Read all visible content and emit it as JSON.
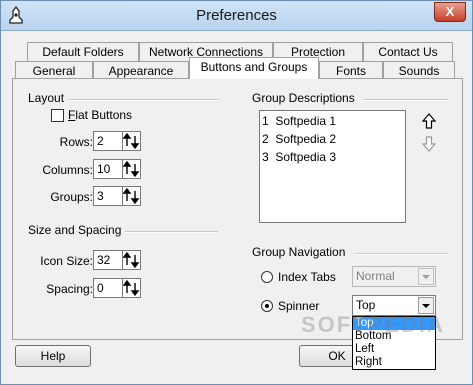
{
  "window": {
    "title": "Preferences",
    "close_glyph": "X"
  },
  "tabs_row1": [
    "Default Folders",
    "Network Connections",
    "Protection",
    "Contact Us"
  ],
  "tabs_row2": [
    "General",
    "Appearance",
    "Buttons and Groups",
    "Fonts",
    "Sounds"
  ],
  "selected_tab": "Buttons and Groups",
  "layout": {
    "heading": "Layout",
    "flat_buttons_label": "Flat Buttons",
    "flat_buttons_checked": false,
    "rows_label": "Rows:",
    "rows_value": "2",
    "columns_label": "Columns:",
    "columns_value": "10",
    "groups_label": "Groups:",
    "groups_value": "3"
  },
  "size_spacing": {
    "heading": "Size and Spacing",
    "icon_size_label": "Icon Size:",
    "icon_size_value": "32",
    "spacing_label": "Spacing:",
    "spacing_value": "0"
  },
  "group_descriptions": {
    "heading": "Group Descriptions",
    "items": [
      {
        "num": "1",
        "name": "Softpedia 1"
      },
      {
        "num": "2",
        "name": "Softpedia 2"
      },
      {
        "num": "3",
        "name": "Softpedia 3"
      }
    ]
  },
  "group_navigation": {
    "heading": "Group Navigation",
    "index_tabs_label": "Index Tabs",
    "index_tabs_value": "Normal",
    "spinner_label": "Spinner",
    "spinner_value": "Top",
    "selected_option": "spinner",
    "dropdown_options": [
      "Top",
      "Bottom",
      "Left",
      "Right"
    ],
    "dropdown_highlight": "Top"
  },
  "buttons": {
    "help": "Help",
    "ok": "OK"
  },
  "watermark": "SOFTPEDIA"
}
